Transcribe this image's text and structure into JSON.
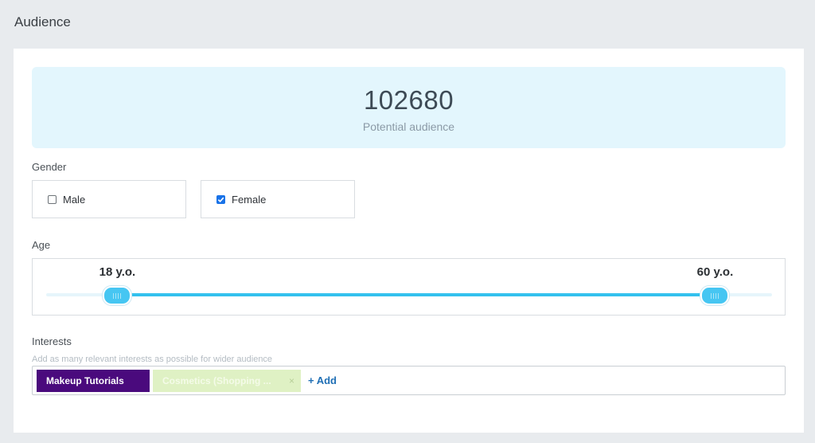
{
  "page": {
    "title": "Audience"
  },
  "audience": {
    "count": "102680",
    "caption": "Potential audience"
  },
  "gender": {
    "label": "Gender",
    "options": [
      {
        "label": "Male",
        "checked": false
      },
      {
        "label": "Female",
        "checked": true
      }
    ]
  },
  "age": {
    "label": "Age",
    "min_label": "18 y.o.",
    "max_label": "60 y.o.",
    "min_value": 18,
    "max_value": 60
  },
  "interests": {
    "label": "Interests",
    "hint": "Add as many relevant interests as possible for wider audience",
    "tags": [
      {
        "label": "Makeup Tutorials"
      },
      {
        "label": "Cosmetics (Shopping ...",
        "remove": "×"
      }
    ],
    "add_label": "+ Add"
  },
  "colors": {
    "accent": "#33c1ee",
    "tag_primary": "#4a0a7d",
    "tag_secondary": "#dff1c4",
    "link": "#1f6fb5"
  }
}
